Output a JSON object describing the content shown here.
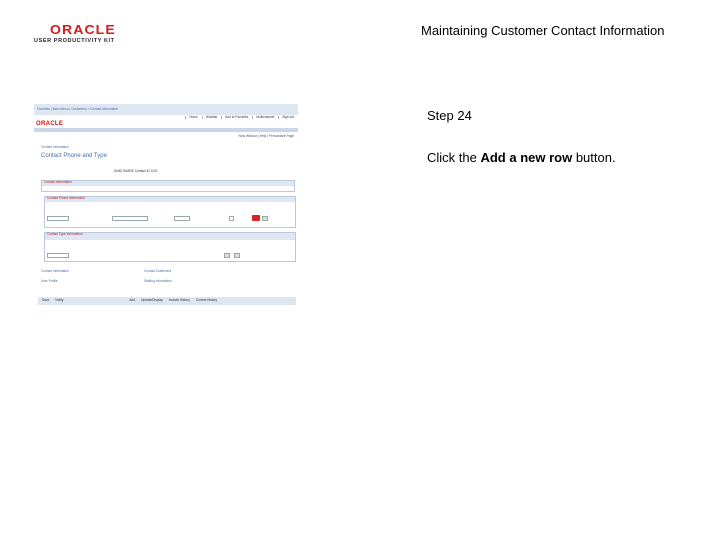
{
  "header": {
    "logo_word": "ORACLE",
    "logo_sub": "USER PRODUCTIVITY KIT",
    "doc_title": "Maintaining Customer Contact Information"
  },
  "step": {
    "label": "Step 24",
    "instruction_prefix": "Click the ",
    "instruction_bold": "Add a new row",
    "instruction_suffix": " button."
  },
  "screenshot": {
    "nav": "Favorites | Main Menu | Customers > Contact Information",
    "tabs": [
      "Home",
      "Worklist",
      "Add to Favorites",
      "Multichannel",
      "Sign out"
    ],
    "brand": "ORACLE",
    "right_links": "New Window | Help | Personalize Page",
    "breadcrumb": "Contact Information",
    "page_title": "Contact Phone and Type",
    "setid": "SetID  SHARE        Contact ID  1021",
    "section1": "Contact Information",
    "section2": "Contact Phone Information",
    "section3": "Contact Type Information",
    "links": [
      "Contact Information",
      "User Profile",
      "Contact Customers",
      "Staffing Information"
    ],
    "buttons": [
      "Save",
      "Notify",
      "Add",
      "Update/Display",
      "Include History",
      "Correct History"
    ]
  },
  "colors": {
    "accent_red": "#d21d1d",
    "link_blue": "#4a6fa1"
  }
}
